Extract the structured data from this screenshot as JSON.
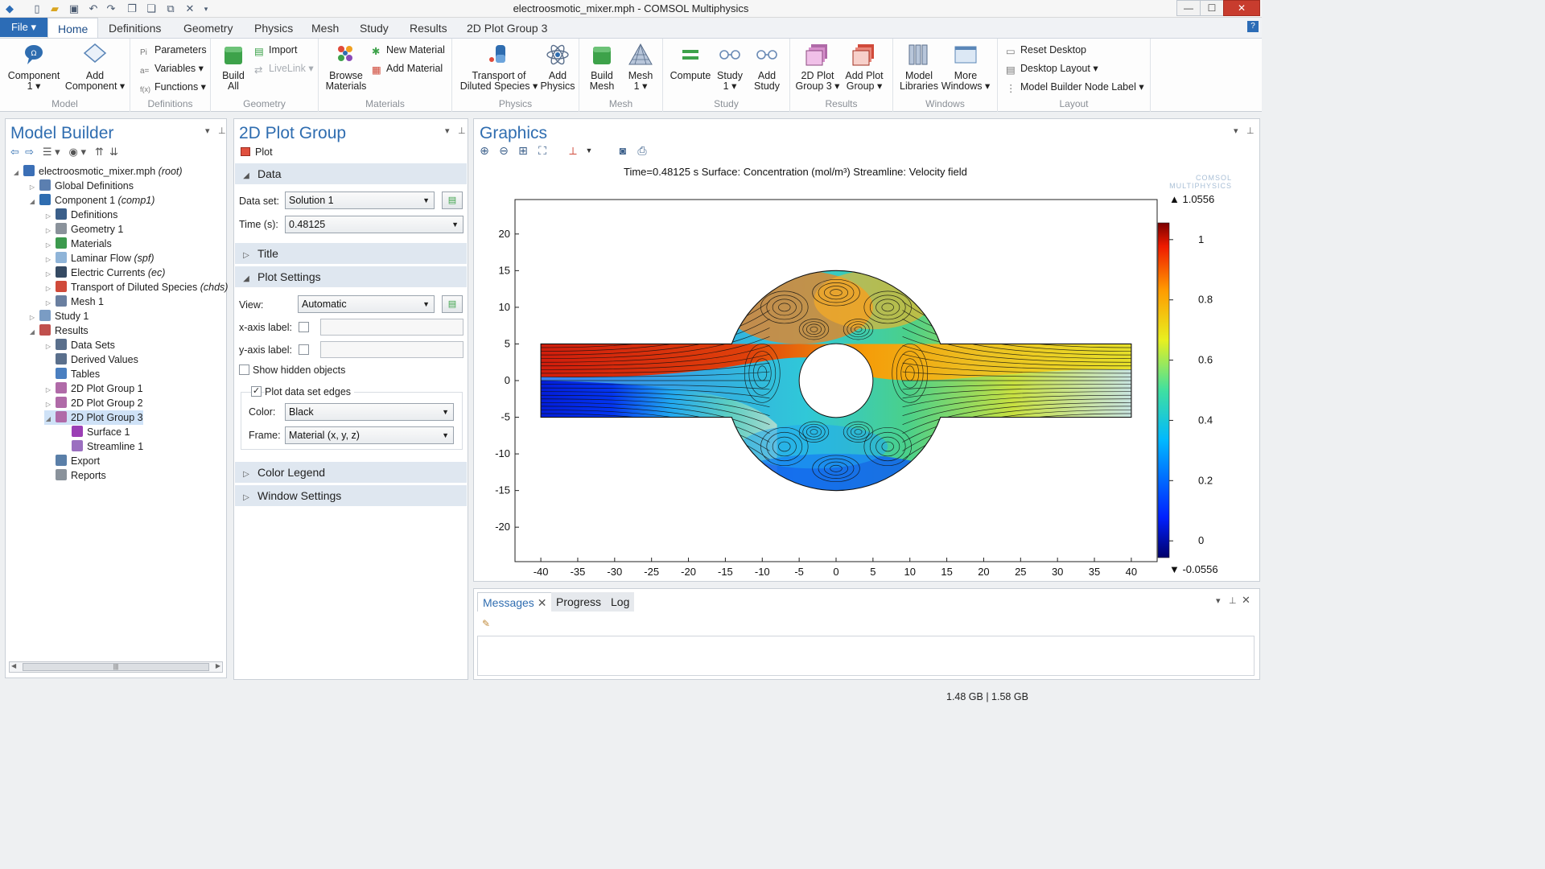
{
  "window": {
    "title": "electroosmotic_mixer.mph - COMSOL Multiphysics",
    "minimize": "—",
    "maximize": "☐",
    "close": "✕"
  },
  "ribbon_tabs": {
    "file": "File ▾",
    "tabs": [
      "Home",
      "Definitions",
      "Geometry",
      "Physics",
      "Mesh",
      "Study",
      "Results",
      "2D Plot Group 3"
    ],
    "help": "?"
  },
  "ribbon": {
    "model": {
      "component": "Component",
      "component_sub": "1 ▾",
      "add_component": "Add",
      "add_component_sub": "Component ▾",
      "label": "Model"
    },
    "definitions": {
      "parameters": "Parameters",
      "variables": "Variables ▾",
      "functions": "Functions ▾",
      "label": "Definitions"
    },
    "geometry": {
      "build_all": "Build",
      "build_all_sub": "All",
      "import": "Import",
      "livelink": "LiveLink ▾",
      "label": "Geometry"
    },
    "materials": {
      "browse": "Browse",
      "browse_sub": "Materials",
      "new_material": "New Material",
      "add_material": "Add Material",
      "label": "Materials"
    },
    "physics": {
      "transport": "Transport of",
      "transport_sub": "Diluted Species ▾",
      "add_physics": "Add",
      "add_physics_sub": "Physics",
      "label": "Physics"
    },
    "mesh": {
      "build_mesh": "Build",
      "build_mesh_sub": "Mesh",
      "mesh1": "Mesh",
      "mesh1_sub": "1 ▾",
      "label": "Mesh"
    },
    "study": {
      "compute": "Compute",
      "study1": "Study",
      "study1_sub": "1 ▾",
      "add_study": "Add",
      "add_study_sub": "Study",
      "label": "Study"
    },
    "results": {
      "plot_group": "2D Plot",
      "plot_group_sub": "Group 3 ▾",
      "add_plot_group": "Add Plot",
      "add_plot_group_sub": "Group ▾",
      "label": "Results"
    },
    "windows": {
      "model_libraries": "Model",
      "model_libraries_sub": "Libraries",
      "more_windows": "More",
      "more_windows_sub": "Windows ▾",
      "label": "Windows"
    },
    "layout": {
      "reset_desktop": "Reset Desktop",
      "desktop_layout": "Desktop Layout ▾",
      "node_label": "Model Builder Node Label ▾",
      "label": "Layout"
    }
  },
  "model_builder": {
    "title": "Model Builder",
    "tree": [
      {
        "label": "electroosmotic_mixer.mph",
        "suffix": "(root)",
        "level": 0,
        "expander": "◢",
        "icon": "file-icon",
        "color": "#3b6fb6"
      },
      {
        "label": "Global Definitions",
        "suffix": "",
        "level": 1,
        "expander": "▷",
        "icon": "global-definitions-icon",
        "color": "#5b7fb0"
      },
      {
        "label": "Component 1",
        "suffix": "(comp1)",
        "level": 1,
        "expander": "◢",
        "icon": "component-icon",
        "color": "#2f6db0"
      },
      {
        "label": "Definitions",
        "suffix": "",
        "level": 2,
        "expander": "▷",
        "icon": "definitions-icon",
        "color": "#3b5f8a"
      },
      {
        "label": "Geometry 1",
        "suffix": "",
        "level": 2,
        "expander": "▷",
        "icon": "geometry-icon",
        "color": "#8a929b"
      },
      {
        "label": "Materials",
        "suffix": "",
        "level": 2,
        "expander": "▷",
        "icon": "materials-icon",
        "color": "#3c9a4e"
      },
      {
        "label": "Laminar Flow",
        "suffix": "(spf)",
        "level": 2,
        "expander": "▷",
        "icon": "laminar-flow-icon",
        "color": "#8fb4d8"
      },
      {
        "label": "Electric Currents",
        "suffix": "(ec)",
        "level": 2,
        "expander": "▷",
        "icon": "electric-currents-icon",
        "color": "#354a63"
      },
      {
        "label": "Transport of Diluted Species",
        "suffix": "(chds)",
        "level": 2,
        "expander": "▷",
        "icon": "transport-icon",
        "color": "#d04a3a"
      },
      {
        "label": "Mesh 1",
        "suffix": "",
        "level": 2,
        "expander": "▷",
        "icon": "mesh-icon",
        "color": "#6a7fa0"
      },
      {
        "label": "Study 1",
        "suffix": "",
        "level": 1,
        "expander": "▷",
        "icon": "study-icon",
        "color": "#7a9cc4"
      },
      {
        "label": "Results",
        "suffix": "",
        "level": 1,
        "expander": "◢",
        "icon": "results-icon",
        "color": "#c0504d"
      },
      {
        "label": "Data Sets",
        "suffix": "",
        "level": 2,
        "expander": "▷",
        "icon": "data-sets-icon",
        "color": "#5a6f8c"
      },
      {
        "label": "Derived Values",
        "suffix": "",
        "level": 2,
        "expander": "",
        "icon": "derived-values-icon",
        "color": "#5a6f8c"
      },
      {
        "label": "Tables",
        "suffix": "",
        "level": 2,
        "expander": "",
        "icon": "tables-icon",
        "color": "#4a7fc0"
      },
      {
        "label": "2D Plot Group 1",
        "suffix": "",
        "level": 2,
        "expander": "▷",
        "icon": "plot-group-icon",
        "color": "#b06aa8"
      },
      {
        "label": "2D Plot Group 2",
        "suffix": "",
        "level": 2,
        "expander": "▷",
        "icon": "plot-group-icon",
        "color": "#b06aa8"
      },
      {
        "label": "2D Plot Group 3",
        "suffix": "",
        "level": 2,
        "expander": "◢",
        "icon": "plot-group-icon",
        "color": "#b06aa8",
        "selected": true
      },
      {
        "label": "Surface 1",
        "suffix": "",
        "level": 3,
        "expander": "",
        "icon": "surface-icon",
        "color": "#9b3fb5"
      },
      {
        "label": "Streamline 1",
        "suffix": "",
        "level": 3,
        "expander": "",
        "icon": "streamline-icon",
        "color": "#9b6fc0"
      },
      {
        "label": "Export",
        "suffix": "",
        "level": 2,
        "expander": "",
        "icon": "export-icon",
        "color": "#5a7fa8"
      },
      {
        "label": "Reports",
        "suffix": "",
        "level": 2,
        "expander": "",
        "icon": "reports-icon",
        "color": "#8a929b"
      }
    ],
    "scroll_grip": "|||"
  },
  "settings": {
    "title": "2D Plot Group",
    "plot_label": "Plot",
    "sections": {
      "data": "Data",
      "title": "Title",
      "plot_settings": "Plot Settings",
      "color_legend": "Color Legend",
      "window_settings": "Window Settings"
    },
    "data_set_label": "Data set:",
    "data_set_value": "Solution 1",
    "time_label": "Time (s):",
    "time_value": "0.48125",
    "view_label": "View:",
    "view_value": "Automatic",
    "xaxis_label": "x-axis label:",
    "yaxis_label": "y-axis label:",
    "show_hidden": "Show hidden objects",
    "plot_edges": "Plot data set edges",
    "plot_edges_check": "✓",
    "color_label": "Color:",
    "color_value": "Black",
    "frame_label": "Frame:",
    "frame_value": "Material  (x, y, z)"
  },
  "graphics": {
    "title": "Graphics",
    "plot_title": "Time=0.48125 s   Surface: Concentration (mol/m³)   Streamline: Velocity field",
    "watermark": "COMSOL MULTIPHYSICS",
    "x_ticks": [
      "-40",
      "-35",
      "-30",
      "-25",
      "-20",
      "-15",
      "-10",
      "-5",
      "0",
      "5",
      "10",
      "15",
      "20",
      "25",
      "30",
      "35",
      "40"
    ],
    "y_ticks": [
      "20",
      "15",
      "10",
      "5",
      "0",
      "-5",
      "-10",
      "-15",
      "-20"
    ],
    "colorbar_max": "▲ 1.0556",
    "colorbar_min": "▼ -0.0556",
    "colorbar_ticks": [
      "1",
      "0.8",
      "0.6",
      "0.4",
      "0.2",
      "0"
    ]
  },
  "messages": {
    "tabs": [
      "Messages",
      "Progress",
      "Log"
    ],
    "close": "✕"
  },
  "status": {
    "memory": "1.48 GB | 1.58 GB"
  }
}
